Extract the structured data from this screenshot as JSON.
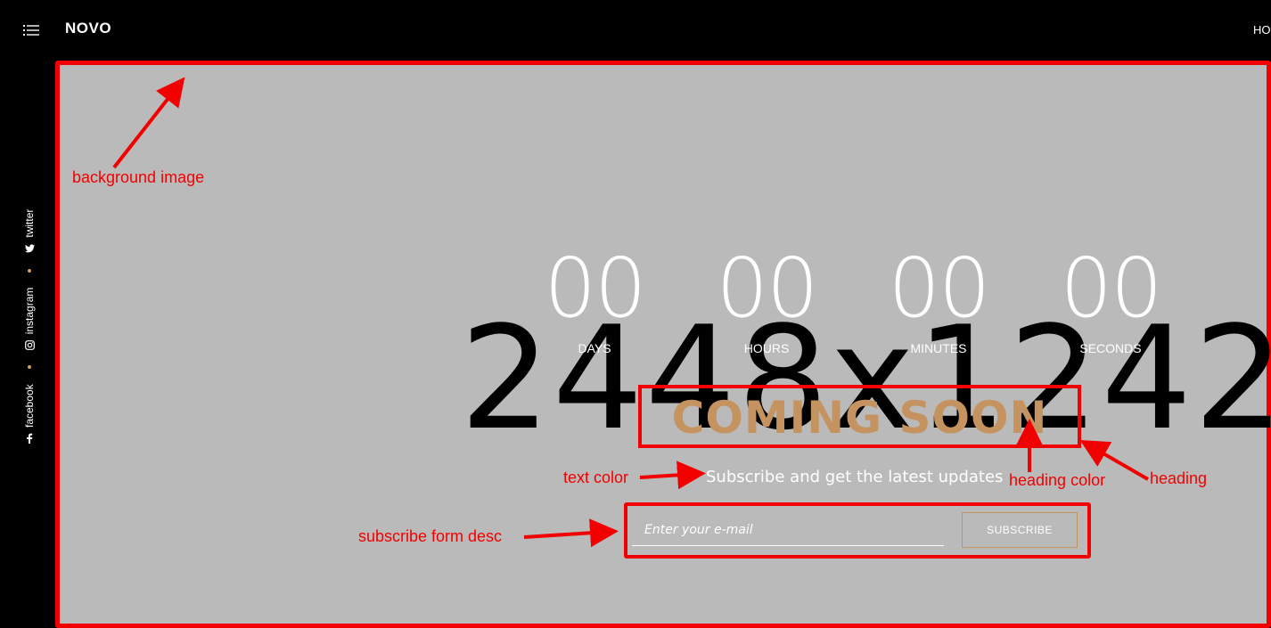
{
  "header": {
    "logo": "NOVO",
    "nav_home": "HO"
  },
  "social": {
    "items": [
      {
        "label": "facebook",
        "icon": "facebook-icon"
      },
      {
        "label": "instagram",
        "icon": "instagram-icon"
      },
      {
        "label": "twitter",
        "icon": "twitter-icon"
      }
    ]
  },
  "hero": {
    "placeholder_dimensions": "2448x1242",
    "countdown": [
      {
        "value": "00",
        "label": "DAYS"
      },
      {
        "value": "00",
        "label": "HOURS"
      },
      {
        "value": "00",
        "label": "MINUTES"
      },
      {
        "value": "00",
        "label": "SECONDS"
      }
    ],
    "heading": "COMING SOON",
    "subtitle": "Subscribe and get the latest updates",
    "form": {
      "email_placeholder": "Enter your e-mail",
      "subscribe_label": "SUBSCRIBE"
    }
  },
  "annotations": {
    "background_image": "background image",
    "text_color": "text color",
    "heading_color": "heading color",
    "heading": "heading",
    "subscribe_form_desc": "subscribe form desc"
  },
  "colors": {
    "page_background": "#000000",
    "hero_background": "#bababa",
    "heading_color": "#c5935f",
    "annotation_red": "#f20000",
    "text_color": "#ffffff"
  }
}
